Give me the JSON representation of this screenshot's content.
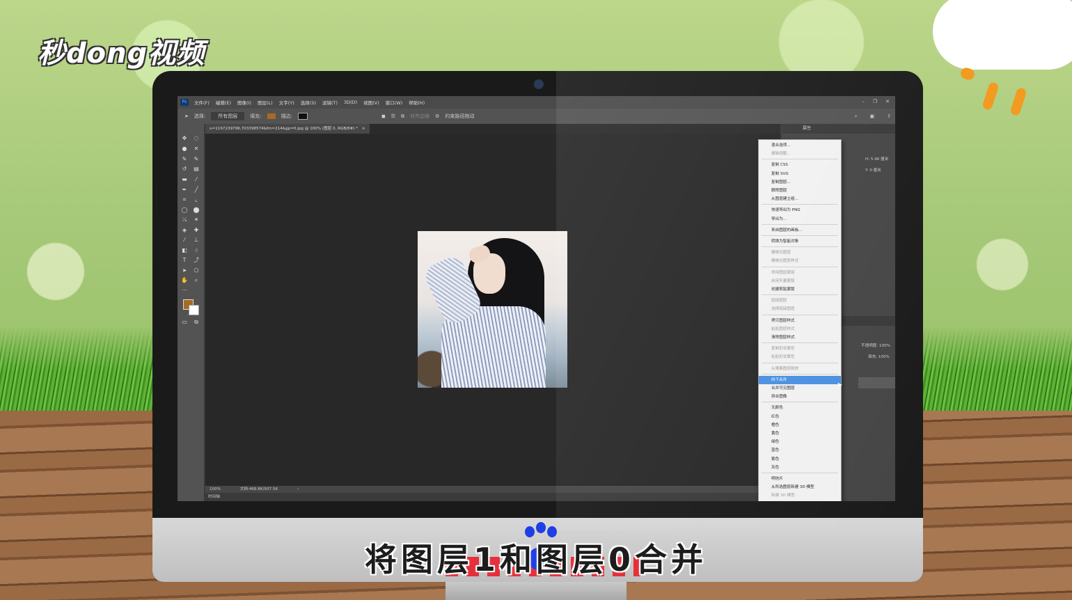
{
  "brand": {
    "logo_text": "秒dong视频"
  },
  "subtitle": "将图层1和图层0合并",
  "app": {
    "badge": "Ps",
    "menu": [
      "文件(F)",
      "编辑(E)",
      "图像(I)",
      "图层(L)",
      "文字(Y)",
      "选择(S)",
      "滤镜(T)",
      "3D(D)",
      "视图(V)",
      "窗口(W)",
      "帮助(H)"
    ],
    "window_controls": [
      "–",
      "❐",
      "✕"
    ]
  },
  "options_bar": {
    "select_label": "选择:",
    "select_value": "所有图层",
    "fill_label": "填充:",
    "stroke_label": "描边:",
    "align_label": "对齐边缘",
    "constrain_label": "约束路径拖动",
    "fill_color": "#a66b22",
    "stroke_color": "#111111"
  },
  "document": {
    "tab_title": "u=1197239796,703398574&fm=214&gp=0.jpg @ 100% (图层 0, RGB/8#) *",
    "tab_close": "×"
  },
  "status_bar": {
    "zoom": "100%",
    "doc_info": "文档:468.8K/937.5K",
    "arrow": "›"
  },
  "timeline_label": "时间轴",
  "properties_panel": {
    "tab_label": "属性",
    "h_field": "H: 5.96 厘米",
    "y_field": "Y: 0 厘米"
  },
  "layers_panel": {
    "opacity_label": "不透明度: 100%",
    "fill_label": "填充: 100%"
  },
  "context_menu": {
    "items": [
      {
        "label": "混合选项...",
        "disabled": false
      },
      {
        "label": "编辑调整...",
        "disabled": true
      },
      {
        "sep": true
      },
      {
        "label": "复制 CSS",
        "disabled": false
      },
      {
        "label": "复制 SVG",
        "disabled": false
      },
      {
        "label": "复制图层...",
        "disabled": false
      },
      {
        "label": "删除图层",
        "disabled": false
      },
      {
        "label": "从图层建立组...",
        "disabled": false
      },
      {
        "sep": true
      },
      {
        "label": "快速导出为 PNG",
        "disabled": false
      },
      {
        "label": "导出为...",
        "disabled": false
      },
      {
        "sep": true
      },
      {
        "label": "来自图层的画板...",
        "disabled": false
      },
      {
        "sep": true
      },
      {
        "label": "转换为智能对象",
        "disabled": false
      },
      {
        "sep": true
      },
      {
        "label": "栅格化图层",
        "disabled": true
      },
      {
        "label": "栅格化图层样式",
        "disabled": true
      },
      {
        "sep": true
      },
      {
        "label": "停用图层蒙版",
        "disabled": true
      },
      {
        "label": "启用矢量蒙版",
        "disabled": true
      },
      {
        "label": "创建剪贴蒙版",
        "disabled": false
      },
      {
        "sep": true
      },
      {
        "label": "链接图层",
        "disabled": true
      },
      {
        "label": "选择链接图层",
        "disabled": true
      },
      {
        "sep": true
      },
      {
        "label": "拷贝图层样式",
        "disabled": false
      },
      {
        "label": "粘贴图层样式",
        "disabled": true
      },
      {
        "label": "清除图层样式",
        "disabled": false
      },
      {
        "sep": true
      },
      {
        "label": "复制形状属性",
        "disabled": true
      },
      {
        "label": "粘贴形状属性",
        "disabled": true
      },
      {
        "sep": true
      },
      {
        "label": "从隔离图层释放",
        "disabled": true
      },
      {
        "sep": true
      },
      {
        "label": "向下合并",
        "disabled": false,
        "highlighted": true
      },
      {
        "label": "合并可见图层",
        "disabled": false
      },
      {
        "label": "拼合图像",
        "disabled": false
      },
      {
        "sep": true
      },
      {
        "label": "无颜色",
        "disabled": false
      },
      {
        "label": "红色",
        "disabled": false
      },
      {
        "label": "橙色",
        "disabled": false
      },
      {
        "label": "黄色",
        "disabled": false
      },
      {
        "label": "绿色",
        "disabled": false
      },
      {
        "label": "蓝色",
        "disabled": false
      },
      {
        "label": "紫色",
        "disabled": false
      },
      {
        "label": "灰色",
        "disabled": false
      },
      {
        "sep": true
      },
      {
        "label": "明信片",
        "disabled": false
      },
      {
        "label": "从所选图层新建 3D 模型",
        "disabled": false
      },
      {
        "label": "新建 3D 模型",
        "disabled": true
      }
    ]
  },
  "colors": {
    "accent_highlight": "#4a90e0",
    "foreground": "#a66b22",
    "background": "#ffffff"
  }
}
